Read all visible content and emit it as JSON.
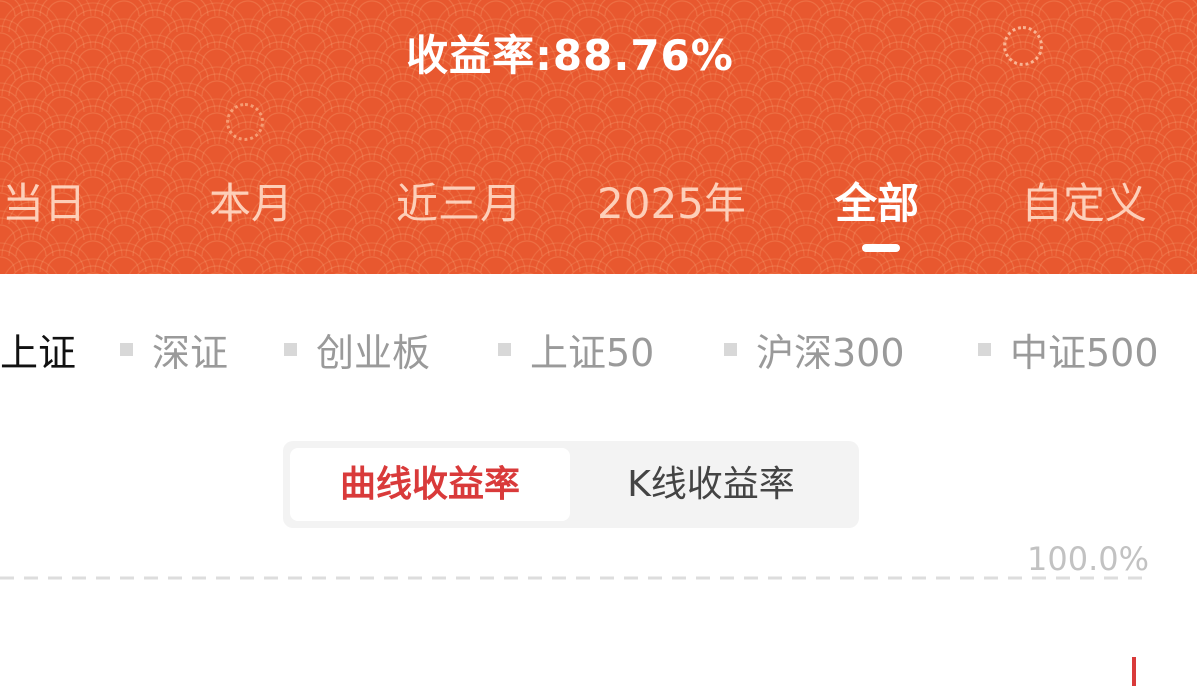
{
  "header": {
    "title": "收益率:88.76%",
    "bg_color": "#e8582f"
  },
  "periods": [
    {
      "label": "当日"
    },
    {
      "label": "本月"
    },
    {
      "label": "近三月"
    },
    {
      "label": "2025年"
    },
    {
      "label": "全部",
      "active": true
    },
    {
      "label": "自定义"
    }
  ],
  "indices": [
    {
      "label": "上证",
      "active": true
    },
    {
      "label": "深证"
    },
    {
      "label": "创业板"
    },
    {
      "label": "上证50"
    },
    {
      "label": "沪深300"
    },
    {
      "label": "中证500"
    }
  ],
  "modes": {
    "curve": "曲线收益率",
    "kline": "K线收益率"
  },
  "chart": {
    "y_max_label": "100.0%",
    "line_color": "#d93a3a"
  }
}
